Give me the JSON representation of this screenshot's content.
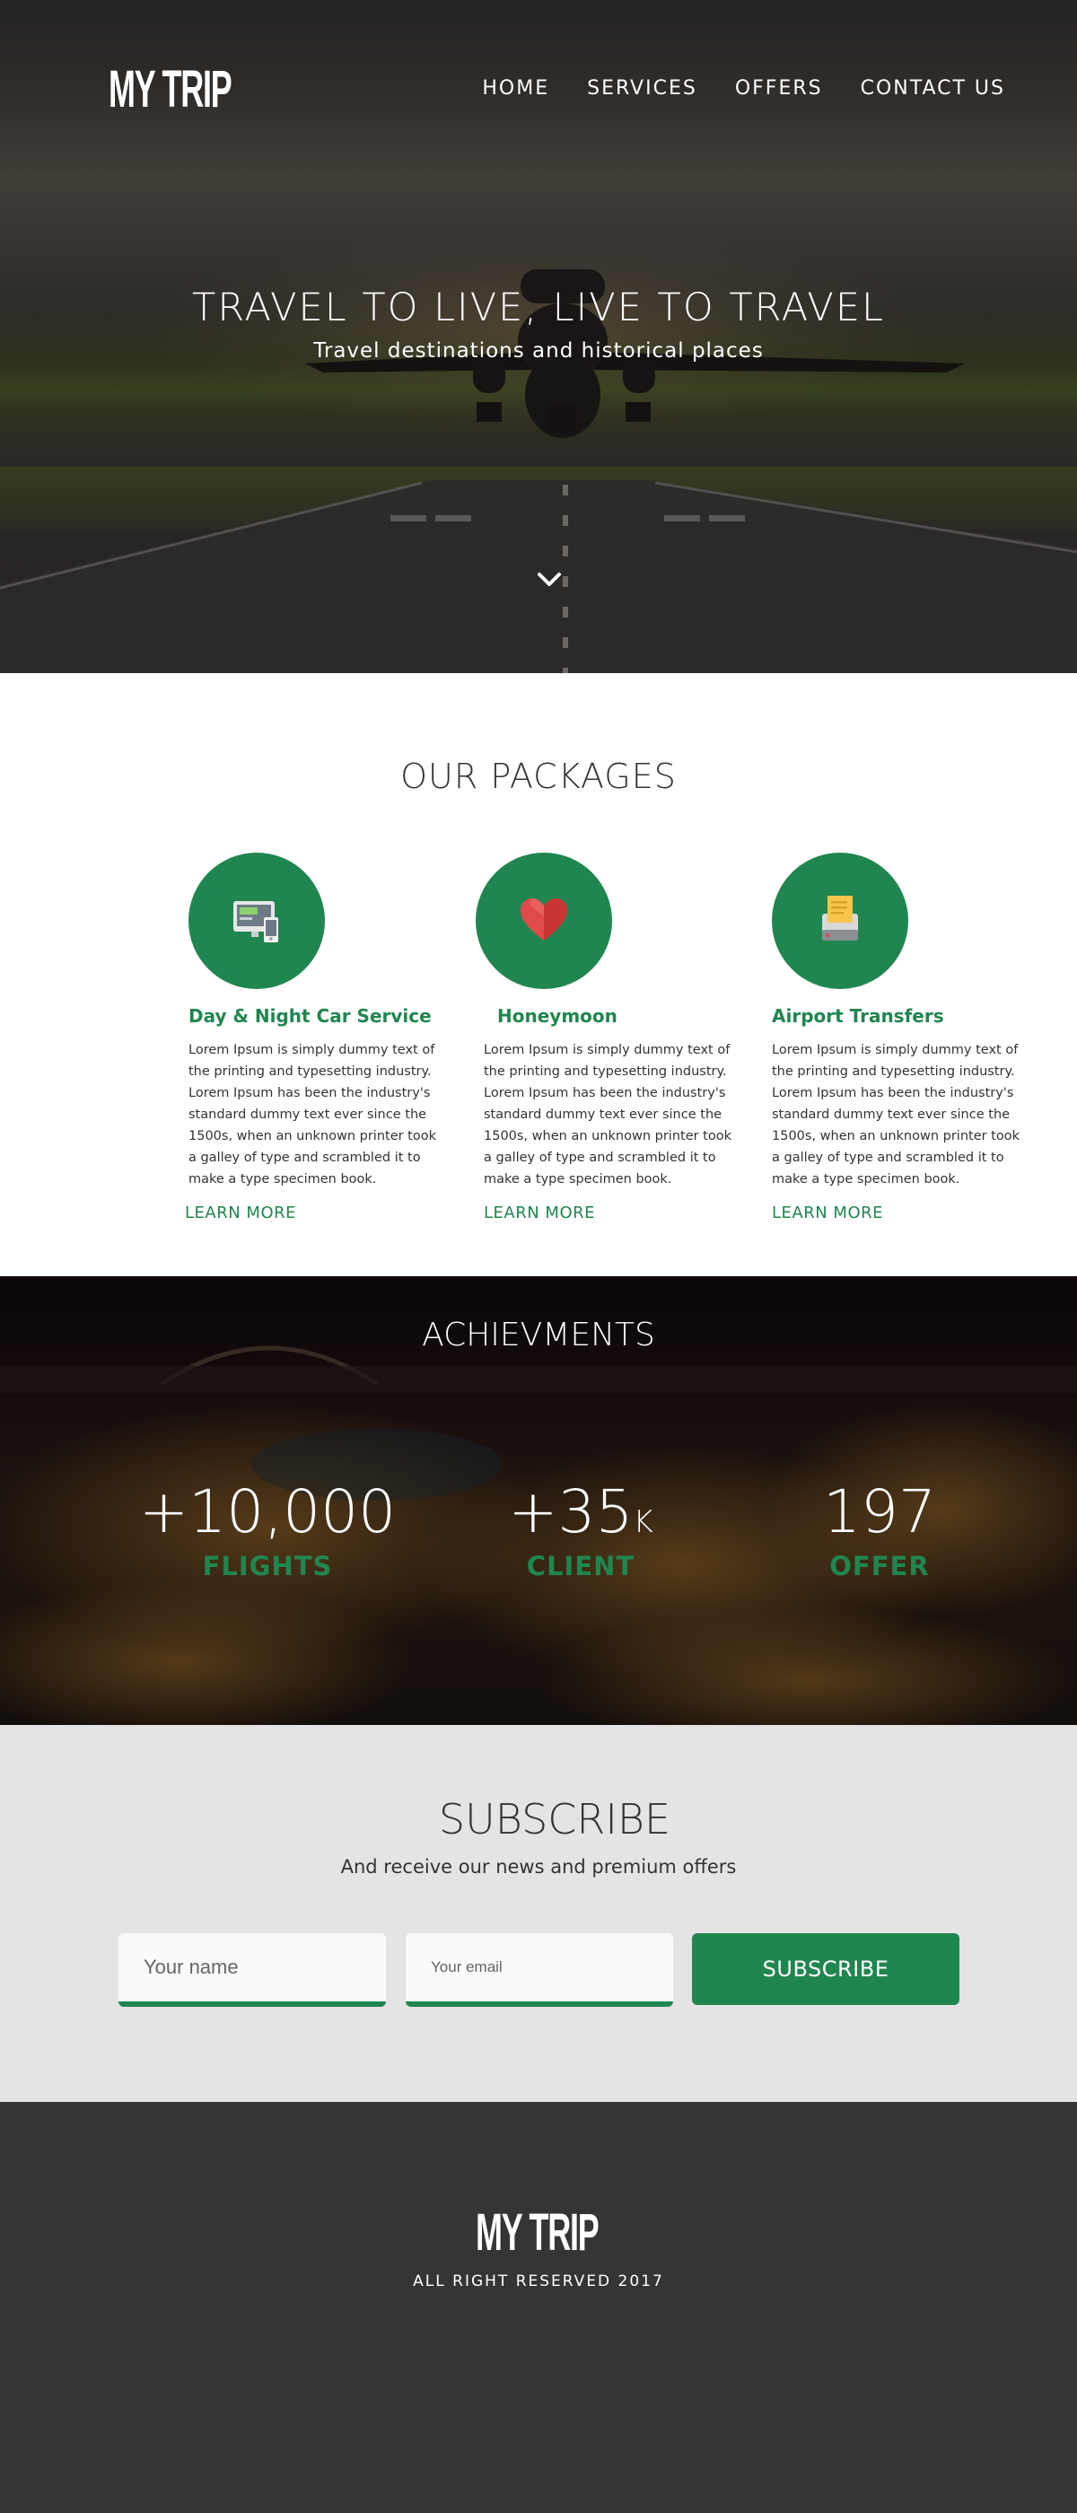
{
  "brand": {
    "name": "MY TRIP",
    "accent_color": "#20864f"
  },
  "nav": {
    "items": [
      "HOME",
      "SERVICES",
      "OFFERS",
      "CONTACT US"
    ]
  },
  "hero": {
    "title": "TRAVEL TO LIVE, LIVE TO TRAVEL",
    "subtitle": "Travel destinations and historical places",
    "scroll_icon": "chevron-down-icon"
  },
  "packages": {
    "title": "OUR PACKAGES",
    "items": [
      {
        "icon": "car-service-icon",
        "title": "Day & Night Car Service",
        "text": "Lorem Ipsum is simply dummy text of the printing and typesetting industry. Lorem Ipsum has been the industry's standard dummy text ever since the 1500s, when an unknown printer took a galley of type and scrambled it to make a type specimen book.",
        "link": "LEARN MORE"
      },
      {
        "icon": "heart-icon",
        "title": "Honeymoon",
        "text": "Lorem Ipsum is simply dummy text of the printing and typesetting industry. Lorem Ipsum has been the industry's standard dummy text ever since the 1500s, when an unknown printer took a galley of type and scrambled it to make a type specimen book.",
        "link": "LEARN MORE"
      },
      {
        "icon": "airport-transfer-icon",
        "title": "Airport Transfers",
        "text": "Lorem Ipsum is simply dummy text of the printing and typesetting industry. Lorem Ipsum has been the industry's standard dummy text ever since the 1500s, when an unknown printer took a galley of type and scrambled it to make a type specimen book.",
        "link": "LEARN MORE"
      }
    ]
  },
  "achievements": {
    "title": "ACHIEVMENTS",
    "stats": [
      {
        "value": "+10,000",
        "suffix": "",
        "label": "FLIGHTS"
      },
      {
        "value": "+35",
        "suffix": "K",
        "label": "CLIENT"
      },
      {
        "value": "197",
        "suffix": "",
        "label": "OFFER"
      }
    ]
  },
  "subscribe": {
    "title": "SUBSCRIBE",
    "text": "And receive our news and premium offers",
    "name_placeholder": "Your name",
    "email_placeholder": "Your email",
    "button": "SUBSCRIBE"
  },
  "footer": {
    "brand": "MY TRIP",
    "rights": "ALL RIGHT RESERVED 2017"
  }
}
